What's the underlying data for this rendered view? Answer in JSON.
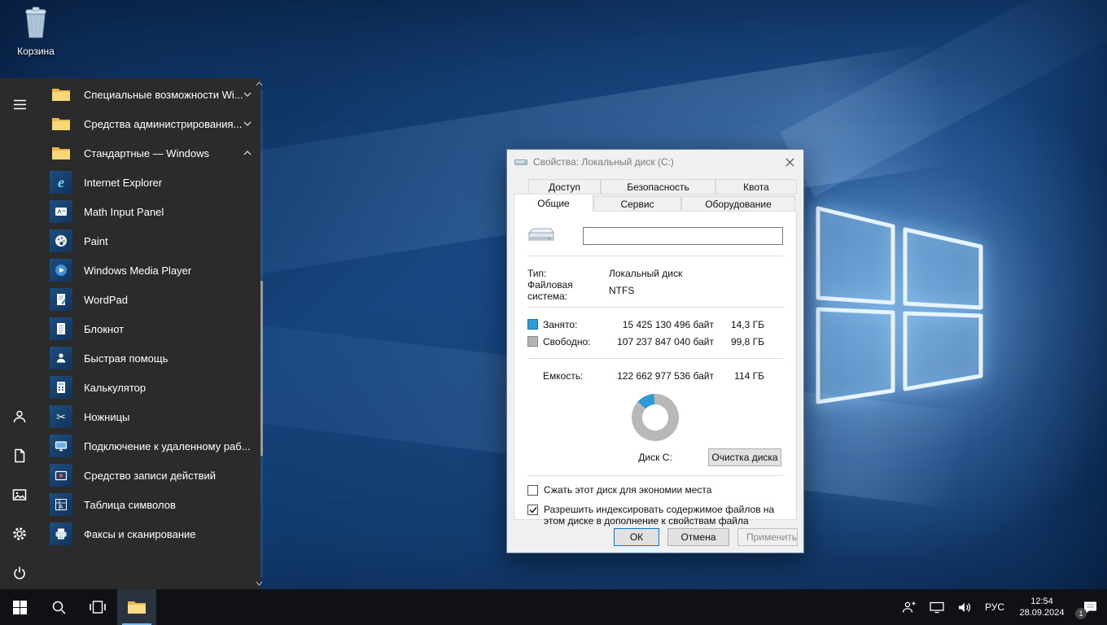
{
  "desktop": {
    "recycle_bin_label": "Корзина"
  },
  "start_menu": {
    "rail_icons": [
      "hamburger-icon",
      "user-icon",
      "documents-icon",
      "pictures-icon",
      "settings-icon",
      "power-icon"
    ],
    "items": [
      {
        "label": "Специальные возможности Wi...",
        "icon": "folder-icon",
        "chevron": "down"
      },
      {
        "label": "Средства администрирования...",
        "icon": "folder-icon",
        "chevron": "down"
      },
      {
        "label": "Стандартные — Windows",
        "icon": "folder-icon",
        "chevron": "up"
      },
      {
        "label": "Internet Explorer",
        "icon": "ie-icon"
      },
      {
        "label": "Math Input Panel",
        "icon": "math-input-icon"
      },
      {
        "label": "Paint",
        "icon": "paint-icon"
      },
      {
        "label": "Windows Media Player",
        "icon": "media-player-icon"
      },
      {
        "label": "WordPad",
        "icon": "wordpad-icon"
      },
      {
        "label": "Блокнот",
        "icon": "notepad-icon"
      },
      {
        "label": "Быстрая помощь",
        "icon": "quick-assist-icon"
      },
      {
        "label": "Калькулятор",
        "icon": "calculator-icon"
      },
      {
        "label": "Ножницы",
        "icon": "snipping-icon"
      },
      {
        "label": "Подключение к удаленному раб...",
        "icon": "rdp-icon"
      },
      {
        "label": "Средство записи действий",
        "icon": "steps-recorder-icon"
      },
      {
        "label": "Таблица символов",
        "icon": "charmap-icon"
      },
      {
        "label": "Факсы и сканирование",
        "icon": "fax-icon"
      }
    ]
  },
  "dialog": {
    "title": "Свойства: Локальный диск (C:)",
    "tabs_back": [
      "Доступ",
      "Безопасность",
      "Квота"
    ],
    "tabs_front": [
      "Общие",
      "Сервис",
      "Оборудование"
    ],
    "active_tab": "Общие",
    "volume_label": {
      "value": ""
    },
    "type_label": "Тип:",
    "type_value": "Локальный диск",
    "fs_label": "Файловая система:",
    "fs_value": "NTFS",
    "usage": [
      {
        "label": "Занято:",
        "bytes": "15 425 130 496 байт",
        "size": "14,3 ГБ",
        "color": "#2e9bd6"
      },
      {
        "label": "Свободно:",
        "bytes": "107 237 847 040 байт",
        "size": "99,8 ГБ",
        "color": "#b3b3b3"
      }
    ],
    "capacity": {
      "label": "Емкость:",
      "bytes": "122 662 977 536 байт",
      "size": "114 ГБ"
    },
    "disk_caption": "Диск C:",
    "cleanup_button": "Очистка диска",
    "checkbox_compress": {
      "label": "Сжать этот диск для экономии места",
      "checked": false
    },
    "checkbox_index": {
      "label": "Разрешить индексировать содержимое файлов на этом диске в дополнение к свойствам файла",
      "checked": true
    },
    "ok_button": "ОК",
    "cancel_button": "Отмена",
    "apply_button": "Применить"
  },
  "taskbar": {
    "language": "РУС",
    "time": "12:54",
    "date": "28.09.2024",
    "notification_badge": "1"
  },
  "chart_data": {
    "type": "pie",
    "labels": [
      "Занято",
      "Свободно"
    ],
    "values_gb": [
      14.3,
      99.8
    ],
    "unit": "ГБ",
    "colors": [
      "#2e9bd6",
      "#b8b8b8"
    ],
    "title": "Диск C:"
  },
  "colors": {
    "used": "#2e9bd6",
    "free": "#b3b3b3",
    "accent": "#0078d7",
    "taskbar": "#101114",
    "start_menu": "#2b2b2b"
  }
}
